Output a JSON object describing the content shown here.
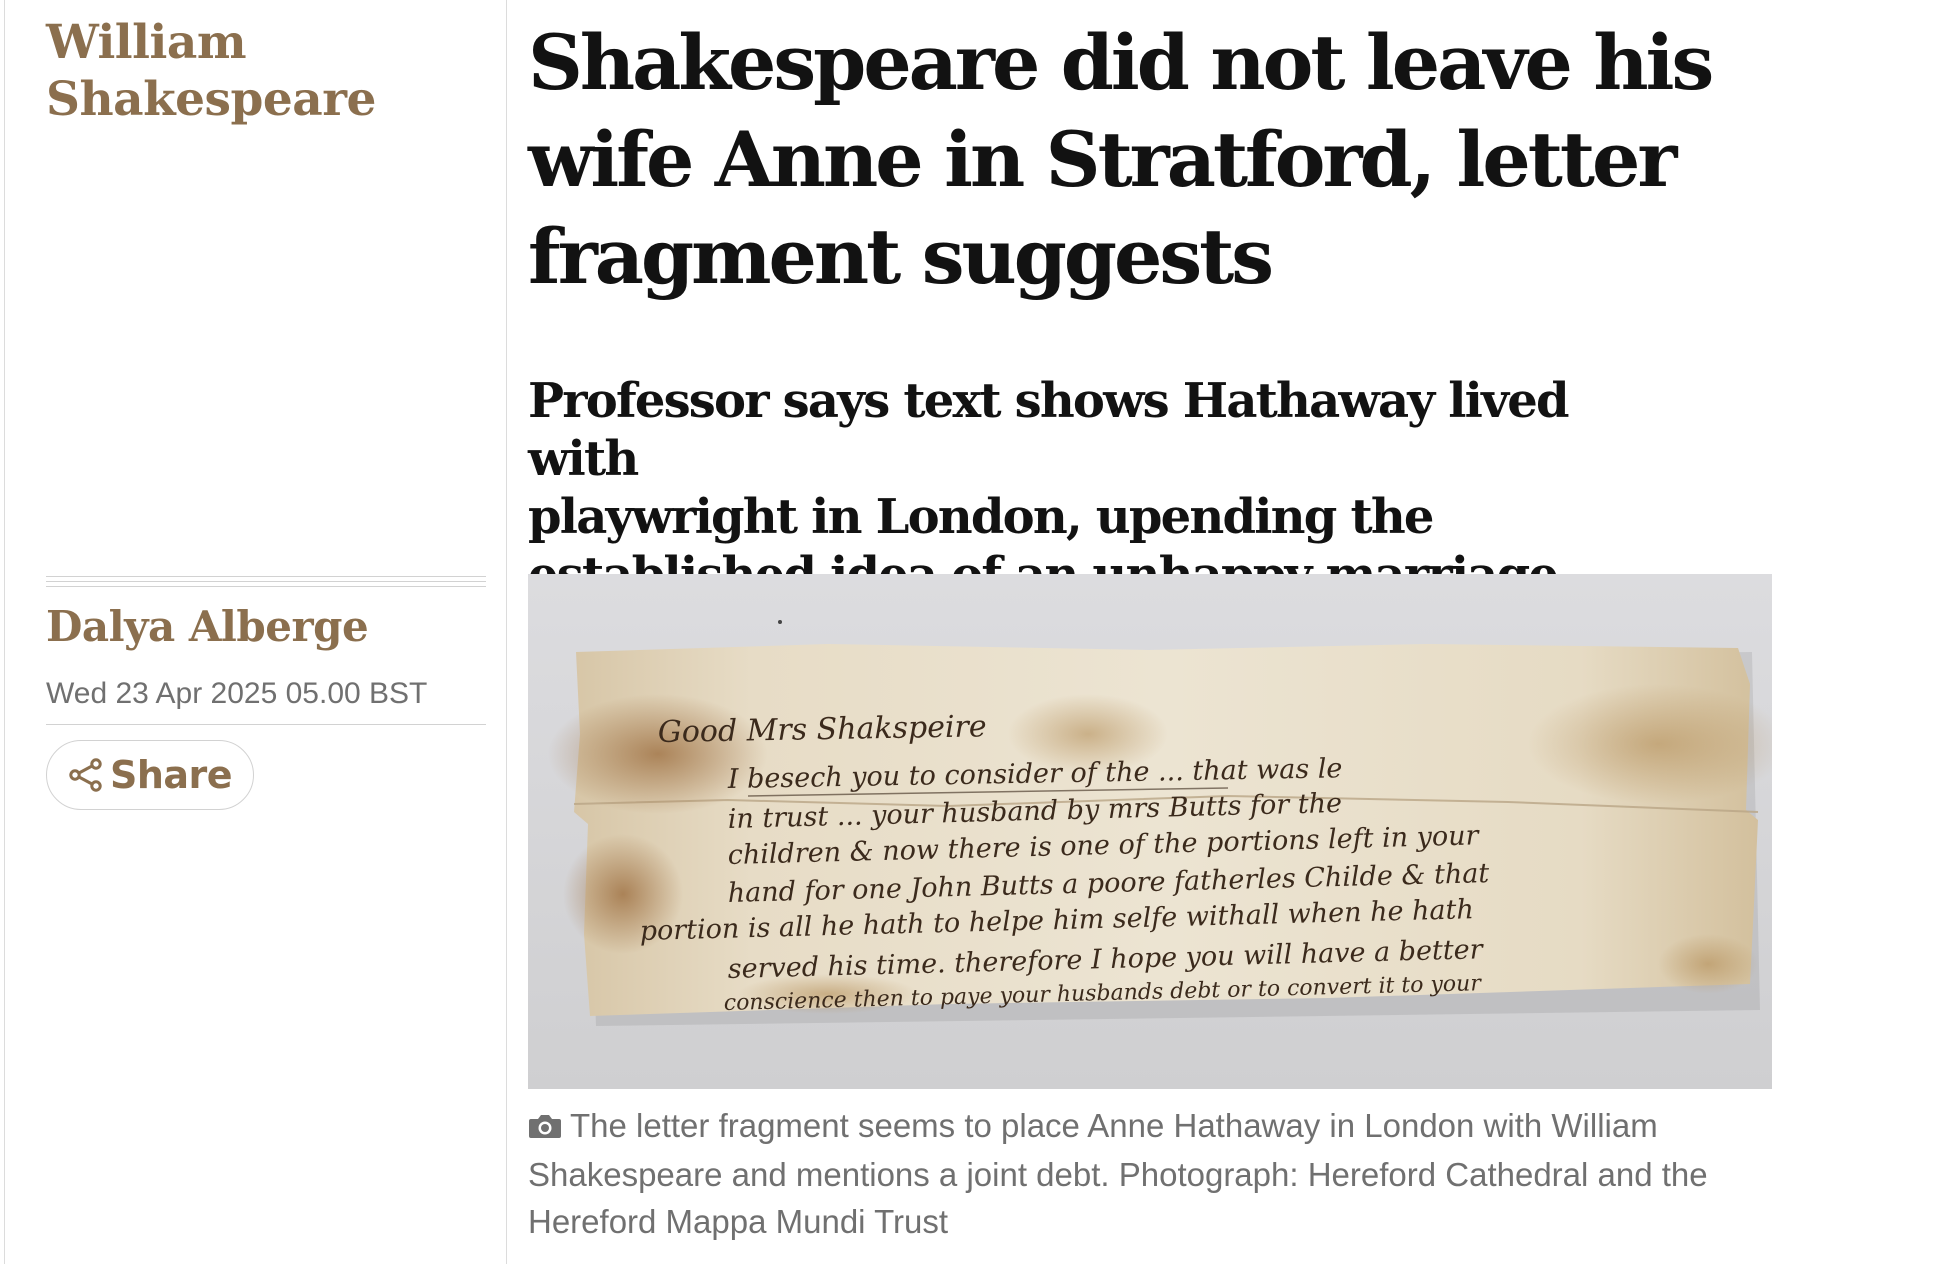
{
  "section": {
    "label_line1": "William",
    "label_line2": "Shakespeare"
  },
  "byline": {
    "author": "Dalya Alberge",
    "date": "Wed 23 Apr 2025 05.00 BST",
    "share_label": "Share"
  },
  "article": {
    "headline_line1": "Shakespeare did not leave his",
    "headline_line2": "wife Anne in Stratford, letter",
    "headline_line3": "fragment suggests",
    "standfirst_line1": "Professor says text shows Hathaway lived with",
    "standfirst_line2": "playwright in London, upending the",
    "standfirst_line3": "established idea of an unhappy marriage"
  },
  "image": {
    "caption": "The letter fragment seems to place Anne Hathaway in London with William Shakespeare and mentions a joint debt. Photograph: Hereford Cathedral and the Hereford Mappa Mundi Trust",
    "handwriting": [
      "Good Mrs Shakspeire",
      "I besech you to consider of the ... that was le",
      "in trust ... your husband by mrs Butts for the",
      "children & now there is one of the portions left in your",
      "hand for one John Butts a poore fatherles Childe & that",
      "portion is all he hath to helpe him selfe withall when he hath",
      "served his time. therefore I hope you will have a better",
      "conscience then to paye your husbands debt or to convert it to your"
    ]
  },
  "colors": {
    "accent": "#8b6f4e",
    "text": "#121212",
    "muted": "#707070",
    "rule": "#dcdcdc"
  },
  "icons": {
    "share": "share-icon",
    "camera": "camera-icon"
  }
}
